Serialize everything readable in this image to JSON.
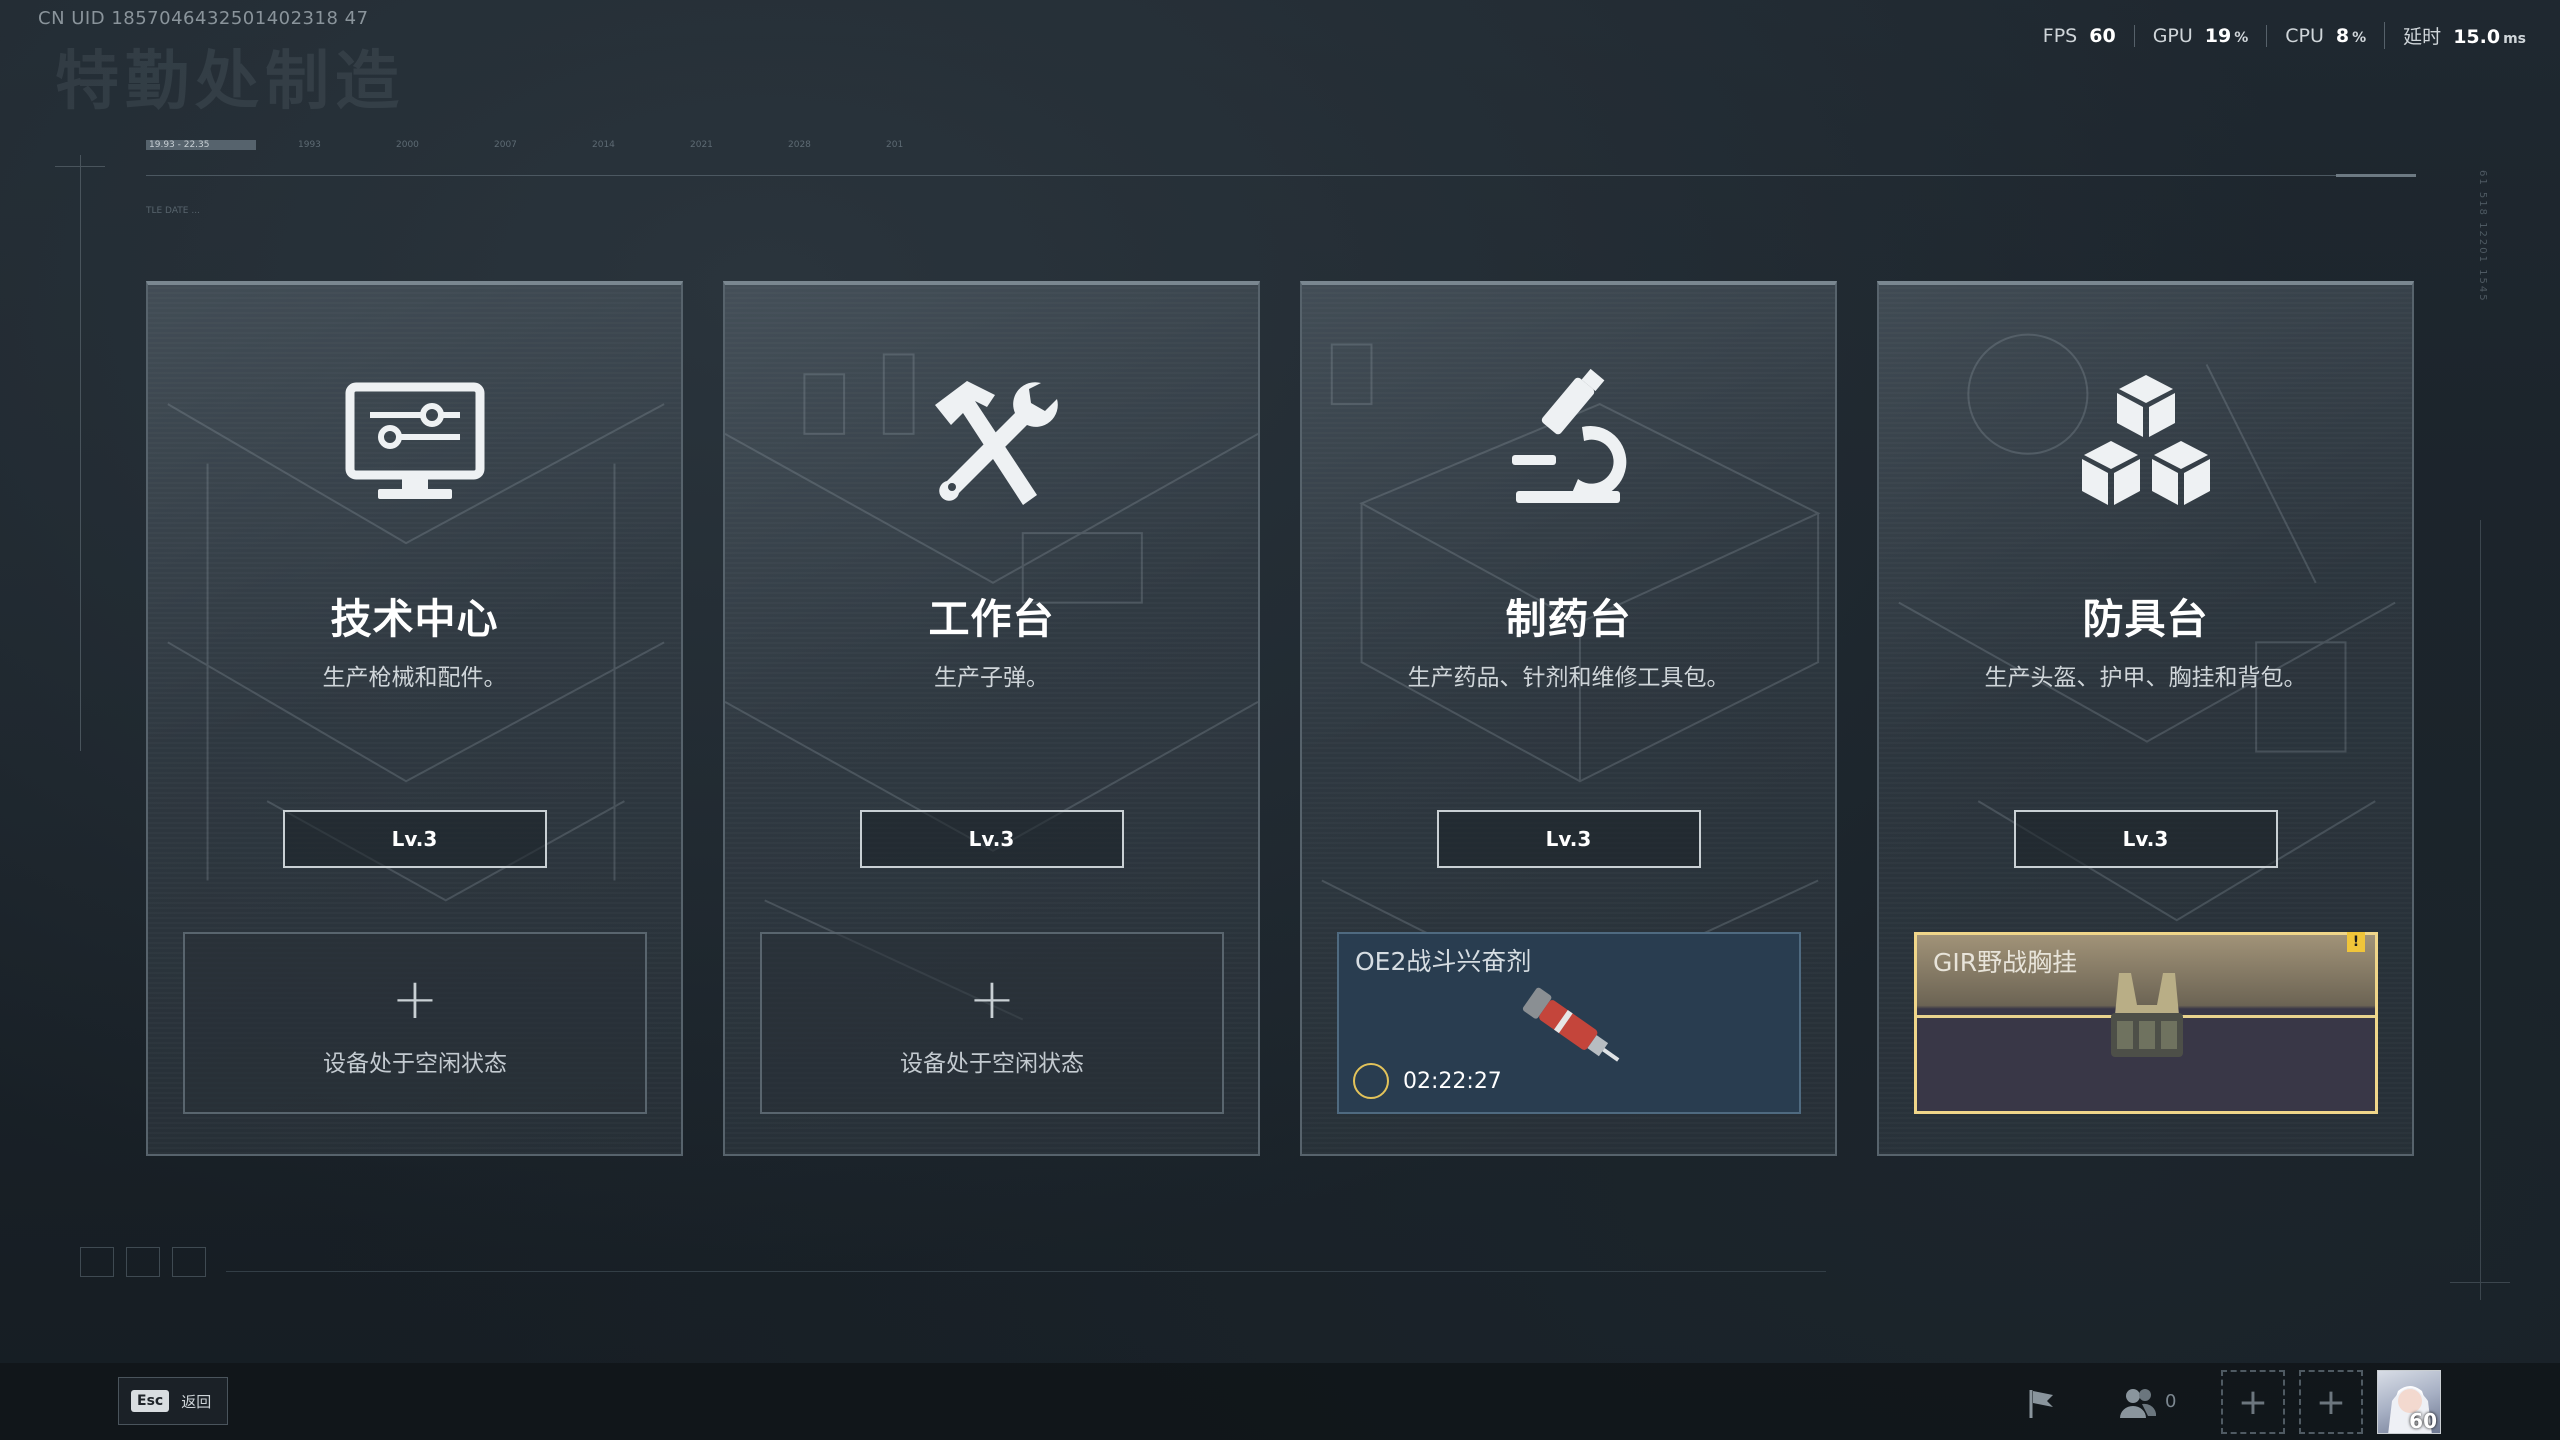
{
  "header": {
    "uid": "CN UID 1857046432501402318 47",
    "bg_title": "特勤处制造"
  },
  "perf": [
    {
      "label": "FPS",
      "value": "60",
      "unit": ""
    },
    {
      "label": "GPU",
      "value": "19",
      "unit": "%"
    },
    {
      "label": "CPU",
      "value": "8",
      "unit": "%"
    },
    {
      "label": "延时",
      "value": "15.0",
      "unit": "ms"
    }
  ],
  "timeline": {
    "ticks": [
      "19.93 - 22.35",
      "1993",
      "2000",
      "2007",
      "2014",
      "2021",
      "2028",
      "201"
    ],
    "sub_date": "TLE DATE ..."
  },
  "side_text": "61 518 12201 1545",
  "cards": [
    {
      "icon": "computer-icon",
      "title": "技术中心",
      "desc": "生产枪械和配件。",
      "level": "Lv.3",
      "slot": {
        "state": "idle",
        "text": "设备处于空闲状态"
      }
    },
    {
      "icon": "hammer-wrench-icon",
      "title": "工作台",
      "desc": "生产子弹。",
      "level": "Lv.3",
      "slot": {
        "state": "idle",
        "text": "设备处于空闲状态"
      }
    },
    {
      "icon": "microscope-icon",
      "title": "制药台",
      "desc": "生产药品、针剂和维修工具包。",
      "level": "Lv.3",
      "slot": {
        "state": "producing",
        "name": "OE2战斗兴奋剂",
        "timer": "02:22:27"
      }
    },
    {
      "icon": "armor-cubes-icon",
      "title": "防具台",
      "desc": "生产头盔、护甲、胸挂和背包。",
      "level": "Lv.3",
      "slot": {
        "state": "done",
        "name": "GIR野战胸挂",
        "badge": "!"
      }
    }
  ],
  "bottom_bar": {
    "esc_key": "Esc",
    "back_label": "返回",
    "friends_count": "0",
    "avatar_level": "60"
  },
  "colors": {
    "accent_gold": "#f0d68a",
    "producing_bg": "#293d50",
    "badge": "#f0c53a"
  }
}
